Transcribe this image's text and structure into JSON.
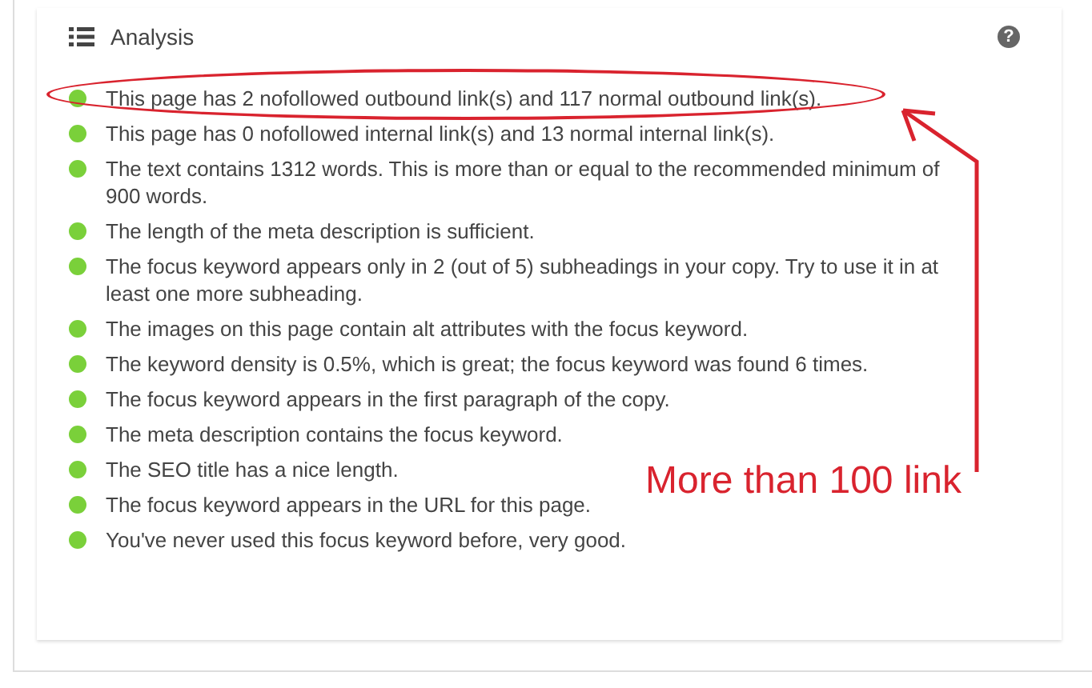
{
  "panel": {
    "title": "Analysis",
    "help": "?"
  },
  "items": [
    {
      "text": "This page has 2 nofollowed outbound link(s) and 117 normal outbound link(s).",
      "highlighted": true
    },
    {
      "text": "This page has 0 nofollowed internal link(s) and 13 normal internal link(s).",
      "highlighted": false
    },
    {
      "text": "The text contains 1312 words. This is more than or equal to the recommended minimum of 900 words.",
      "highlighted": false
    },
    {
      "text": "The length of the meta description is sufficient.",
      "highlighted": false
    },
    {
      "text": "The focus keyword appears only in 2 (out of 5) subheadings in your copy. Try to use it in at least one more subheading.",
      "highlighted": false
    },
    {
      "text": "The images on this page contain alt attributes with the focus keyword.",
      "highlighted": false
    },
    {
      "text": "The keyword density is 0.5%, which is great; the focus keyword was found 6 times.",
      "highlighted": false
    },
    {
      "text": "The focus keyword appears in the first paragraph of the copy.",
      "highlighted": false
    },
    {
      "text": "The meta description contains the focus keyword.",
      "highlighted": false
    },
    {
      "text": "The SEO title has a nice length.",
      "highlighted": false
    },
    {
      "text": "The focus keyword appears in the URL for this page.",
      "highlighted": false
    },
    {
      "text": "You've never used this focus keyword before, very good.",
      "highlighted": false
    }
  ],
  "annotation": {
    "label": "More than 100 link"
  }
}
